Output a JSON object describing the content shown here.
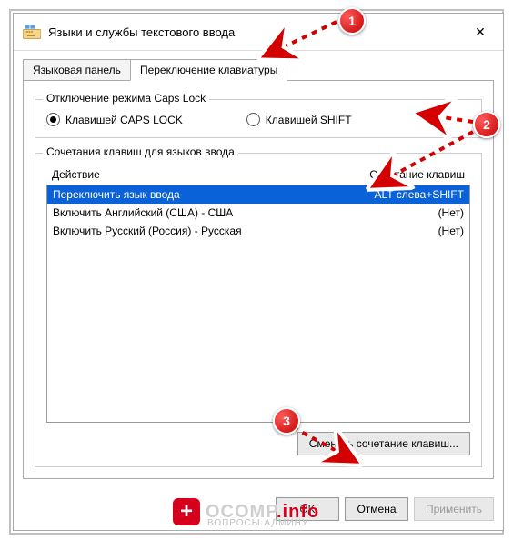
{
  "title": "Языки и службы текстового ввода",
  "close_glyph": "✕",
  "tabs": {
    "language_bar": "Языковая панель",
    "keyboard_switch": "Переключение клавиатуры"
  },
  "capslock_group": {
    "legend": "Отключение режима Caps Lock",
    "caps_label": "Клавишей CAPS LOCK",
    "shift_label": "Клавишей SHIFT"
  },
  "hotkeys_group": {
    "legend": "Сочетания клавиш для языков ввода",
    "header_action": "Действие",
    "header_combo": "Сочетание клавиш",
    "rows": [
      {
        "action": "Переключить язык ввода",
        "combo": "ALT слева+SHIFT"
      },
      {
        "action": "Включить Английский (США) - США",
        "combo": "(Нет)"
      },
      {
        "action": "Включить Русский (Россия) - Русская",
        "combo": "(Нет)"
      }
    ],
    "change_button": "Сменить сочетание клавиш..."
  },
  "footer": {
    "ok": "OK",
    "cancel": "Отмена",
    "apply": "Применить"
  },
  "callouts": {
    "c1": "1",
    "c2": "2",
    "c3": "3"
  },
  "watermark": {
    "main": "OCOMP",
    "suffix": ".info",
    "sub": "ВОПРОСЫ АДМИНУ"
  }
}
